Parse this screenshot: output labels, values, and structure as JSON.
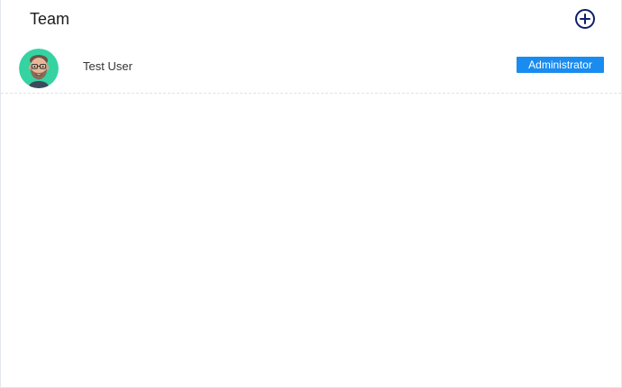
{
  "header": {
    "title": "Team",
    "add_icon": "plus-circle-icon"
  },
  "members": [
    {
      "name": "Test User",
      "role": "Administrator",
      "avatar_icon": "memoji-avatar"
    }
  ],
  "colors": {
    "accent": "#0d1f6b",
    "badge": "#1a8cf0",
    "avatar_bg": "#35d3a2"
  }
}
